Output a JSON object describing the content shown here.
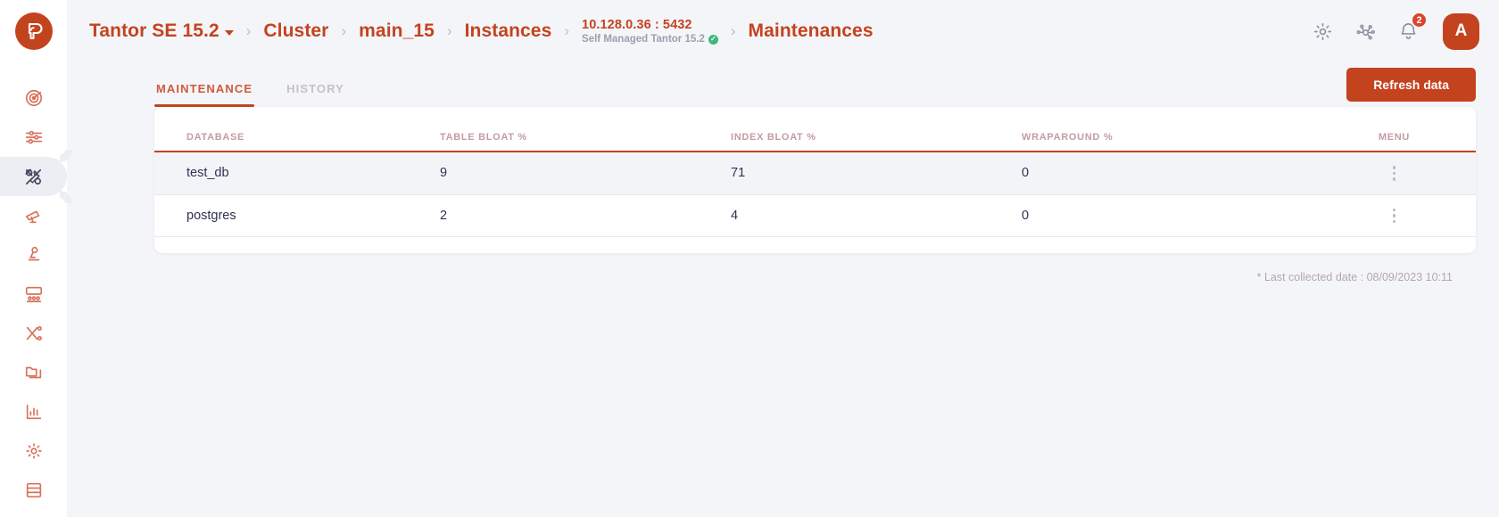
{
  "colors": {
    "brand": "#c4431f",
    "bg": "#f4f5f9",
    "row_highlight": "#f2f4f8",
    "header_text": "#c49ca2",
    "ok_green": "#3cb878",
    "badge_red": "#d8452a"
  },
  "sidebar": {
    "logo_name": "tantor-logo",
    "items": [
      {
        "icon": "radar-icon",
        "name": "sidebar-item-dashboard",
        "active": false
      },
      {
        "icon": "sliders-icon",
        "name": "sidebar-item-settings",
        "active": false
      },
      {
        "icon": "tools-icon",
        "name": "sidebar-item-maintenance",
        "active": true
      },
      {
        "icon": "telescope-icon",
        "name": "sidebar-item-monitoring",
        "active": false
      },
      {
        "icon": "microscope-icon",
        "name": "sidebar-item-analysis",
        "active": false
      },
      {
        "icon": "presentation-icon",
        "name": "sidebar-item-sessions",
        "active": false
      },
      {
        "icon": "shuffle-icon",
        "name": "sidebar-item-replication",
        "active": false
      },
      {
        "icon": "folders-icon",
        "name": "sidebar-item-projects",
        "active": false
      },
      {
        "icon": "bar-chart-icon",
        "name": "sidebar-item-reports",
        "active": false
      },
      {
        "icon": "gear-icon",
        "name": "sidebar-item-configuration",
        "active": false
      },
      {
        "icon": "database-icon",
        "name": "sidebar-item-databases",
        "active": false
      }
    ]
  },
  "breadcrumb": {
    "product": "Tantor SE 15.2",
    "cluster": "Cluster",
    "node": "main_15",
    "instances": "Instances",
    "host": "10.128.0.36 : 5432",
    "host_sub": "Self Managed Tantor 15.2",
    "host_status": "verified",
    "current": "Maintenances",
    "separator": "›"
  },
  "topbar": {
    "settings_icon": "gear-icon",
    "topology_icon": "nodes-icon",
    "bell_icon": "bell-icon",
    "notification_count": "2",
    "avatar_initial": "A"
  },
  "tabs": [
    {
      "label": "MAINTENANCE",
      "active": true
    },
    {
      "label": "HISTORY",
      "active": false
    }
  ],
  "toolbar": {
    "refresh_label": "Refresh data"
  },
  "table": {
    "columns": [
      "DATABASE",
      "TABLE BLOAT %",
      "INDEX BLOAT %",
      "WRAPAROUND %",
      "MENU"
    ],
    "rows": [
      {
        "database": "test_db",
        "table_bloat": "9",
        "index_bloat": "71",
        "wraparound": "0",
        "menu_icon": "kebab-menu-icon",
        "highlight": true
      },
      {
        "database": "postgres",
        "table_bloat": "2",
        "index_bloat": "4",
        "wraparound": "0",
        "menu_icon": "kebab-menu-icon",
        "highlight": false
      }
    ]
  },
  "footer": {
    "last_collected": "* Last collected date : 08/09/2023 10:11"
  }
}
